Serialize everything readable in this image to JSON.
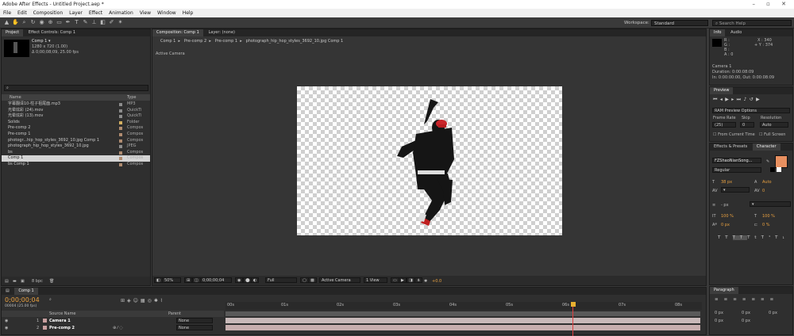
{
  "window": {
    "title": "Adobe After Effects - Untitled Project.aep *",
    "controls": "– ▫ ✕"
  },
  "menu": [
    "File",
    "Edit",
    "Composition",
    "Layer",
    "Effect",
    "Animation",
    "View",
    "Window",
    "Help"
  ],
  "toolbar": {
    "workspace_label": "Workspace:",
    "workspace_value": "Standard",
    "search_placeholder": "Search Help"
  },
  "project_panel": {
    "tabs": [
      "Project",
      "Effect Controls: Comp 1"
    ],
    "comp_name": "Comp 1 ▾",
    "comp_info": [
      "1280 x 720 (1.00)",
      "Δ 0;00;08;09, 25.00 fps"
    ],
    "col_name": "Name",
    "col_type": "Type",
    "items": [
      {
        "name": "字幕翻译10-柱子祖尾面.mp3",
        "type": "MP3",
        "color": "#8c8c8c"
      },
      {
        "name": "光晕炫彩 (24).mov",
        "type": "QuickTi",
        "color": "#8c8c8c"
      },
      {
        "name": "光晕炫彩 (13).mov",
        "type": "QuickTi",
        "color": "#8c8c8c"
      },
      {
        "name": "Solids",
        "type": "Folder",
        "color": "#d4b060"
      },
      {
        "name": "Pre-comp 2",
        "type": "Compos",
        "color": "#b08c70"
      },
      {
        "name": "Pre-comp 1",
        "type": "Compos",
        "color": "#b08c70"
      },
      {
        "name": "photogr...hip_hop_styles_3692_10.jpg Comp 1",
        "type": "Compos",
        "color": "#b08c70"
      },
      {
        "name": "photograph_hip_hop_styles_3692_10.jpg",
        "type": "JPEG",
        "color": "#8c8c8c"
      },
      {
        "name": "bs",
        "type": "Compos",
        "color": "#b08c70"
      },
      {
        "name": "Comp 1",
        "type": "Compos",
        "color": "#b08c70",
        "selected": true
      },
      {
        "name": "bs Comp 1",
        "type": "Compos",
        "color": "#b08c70"
      }
    ],
    "bpc": "8 bpc"
  },
  "composition_panel": {
    "tabs": [
      "Composition: Comp 1",
      "Layer: (none)"
    ],
    "breadcrumbs": [
      "Comp 1",
      "Pre-comp 2",
      "Pre-comp 1",
      "photograph_hip_hop_styles_3692_10.jpg Comp 1"
    ],
    "view_label": "Active Camera",
    "bottom_bar": {
      "zoom": "50%",
      "timecode": "0;00;00;04",
      "resolution": "Full",
      "camera": "Active Camera",
      "views": "1 View",
      "exposure": "+0.0"
    }
  },
  "info_panel": {
    "tabs": [
      "Info",
      "Audio"
    ],
    "rgba": [
      "R :",
      "G :",
      "B :",
      "A : 0"
    ],
    "xy": [
      "X : 340",
      "+ Y : 374"
    ],
    "camera_info": [
      "Camera 1",
      "Duration: 0:00:08:09",
      "In: 0:00:00:00, Out: 0:00:08:09"
    ]
  },
  "preview_panel": {
    "tab": "Preview",
    "ram_options": "RAM Preview Options",
    "frame_rate_label": "Frame Rate",
    "skip_label": "Skip",
    "resolution_label": "Resolution",
    "frame_rate": "(25)",
    "skip": "0",
    "resolution": "Auto",
    "from_current": "From Current Time",
    "full_screen": "Full Screen"
  },
  "character_panel": {
    "tabs": [
      "Effects & Presets",
      "Character"
    ],
    "font": "FZShaoNianSong...",
    "style": "Regular",
    "size": "38 px",
    "leading": "Auto",
    "tracking": "0",
    "stroke": "- px",
    "v_scale": "100 %",
    "h_scale": "100 %",
    "baseline": "0 px",
    "tsume": "0 %",
    "fill_color": "#e89060"
  },
  "paragraph_panel": {
    "tab": "Paragraph",
    "indent_vals": [
      "0 px",
      "0 px",
      "0 px",
      "0 px",
      "0 px"
    ]
  },
  "timeline": {
    "tab": "Comp 1",
    "timecode": "0;00;00;04",
    "fps_sub": "00004 (25.00 fps)",
    "col_source": "Source Name",
    "col_parent": "Parent",
    "layers": [
      {
        "index": "1",
        "name": "Camera 1",
        "parent": "None"
      },
      {
        "index": "2",
        "name": "Pre-comp 2",
        "parent": "None"
      }
    ],
    "ruler": [
      "00s",
      "01s",
      "02s",
      "03s",
      "04s",
      "05s",
      "06s",
      "07s",
      "08s"
    ]
  }
}
